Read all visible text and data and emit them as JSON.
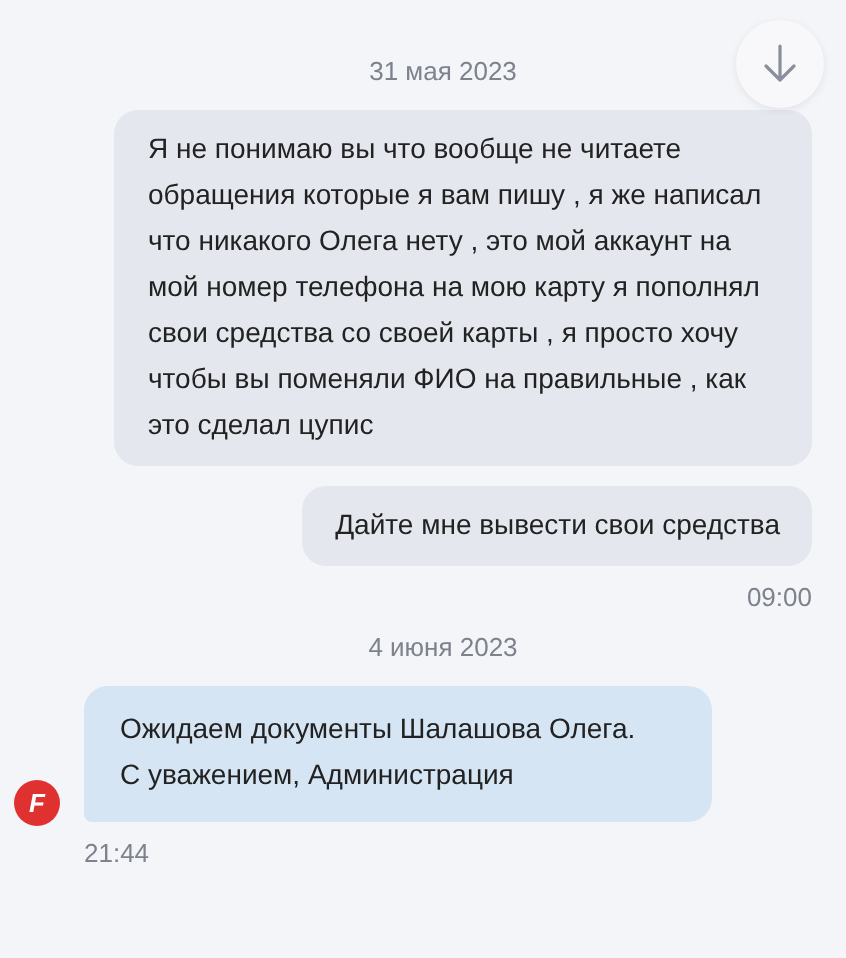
{
  "items": [
    {
      "kind": "date",
      "text": "31 мая 2023"
    },
    {
      "kind": "outgoing",
      "text": "Я не понимаю вы что вообще не читаете обращения которые я вам пишу , я же написал что никакого Олега нету , это мой аккаунт на мой номер телефона на мою карту я пополнял свои средства со своей карты , я просто хочу чтобы вы поменяли ФИО на правильные , как это сделал цупис"
    },
    {
      "kind": "outgoing",
      "text": "Дайте мне вывести свои средства",
      "time": "09:00"
    },
    {
      "kind": "date",
      "text": "4 июня 2023"
    },
    {
      "kind": "incoming",
      "lines": [
        "Ожидаем документы Шалашова Олега.",
        "С уважением, Администрация"
      ],
      "avatar_letter": "F",
      "time": "21:44"
    }
  ]
}
